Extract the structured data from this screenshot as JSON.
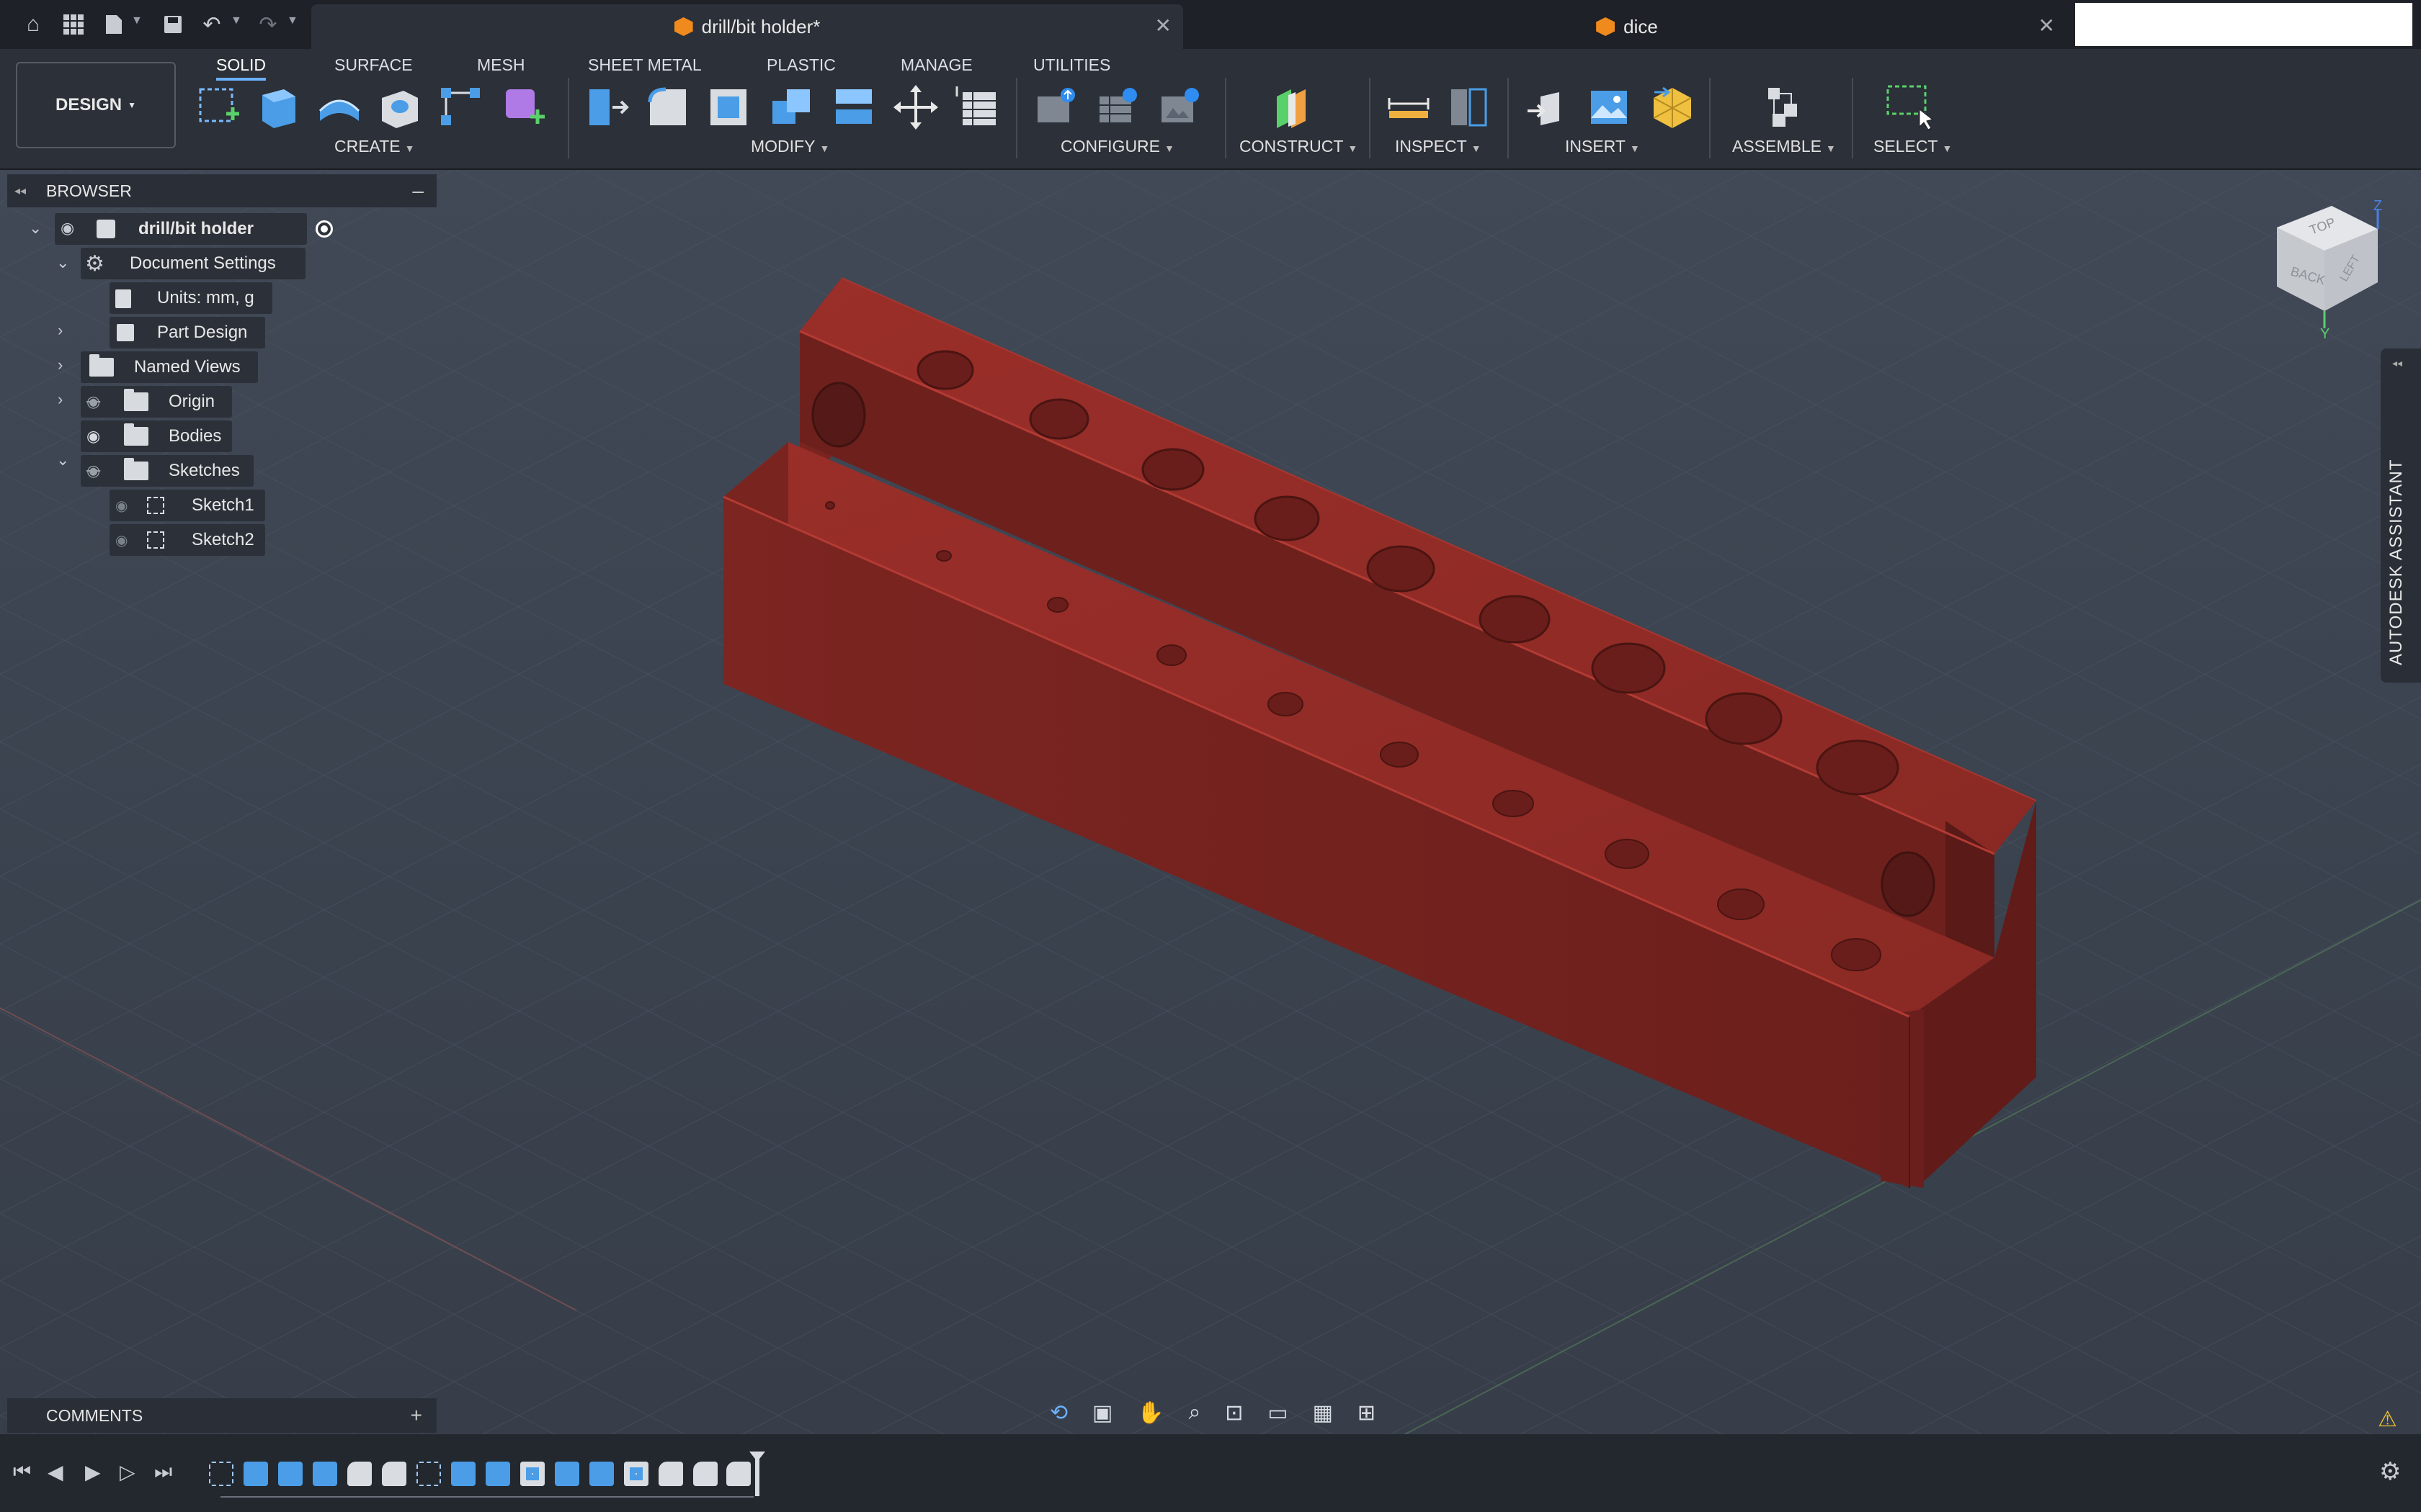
{
  "titlebar": {
    "tabs": [
      {
        "label": "drill/bit holder*",
        "active": true
      },
      {
        "label": "dice",
        "active": false
      }
    ]
  },
  "ribbon": {
    "workspace": "DESIGN",
    "tabs": [
      "SOLID",
      "SURFACE",
      "MESH",
      "SHEET METAL",
      "PLASTIC",
      "MANAGE",
      "UTILITIES"
    ],
    "groups": [
      "CREATE",
      "MODIFY",
      "CONFIGURE",
      "CONSTRUCT",
      "INSPECT",
      "INSERT",
      "ASSEMBLE",
      "SELECT"
    ]
  },
  "browser": {
    "title": "BROWSER",
    "root": "drill/bit holder",
    "items": [
      {
        "label": "Document Settings"
      },
      {
        "label": "Units: mm, g"
      },
      {
        "label": "Part Design"
      },
      {
        "label": "Named Views"
      },
      {
        "label": "Origin"
      },
      {
        "label": "Bodies"
      },
      {
        "label": "Sketches"
      },
      {
        "label": "Sketch1"
      },
      {
        "label": "Sketch2"
      }
    ]
  },
  "viewcube": {
    "top": "TOP",
    "back": "BACK",
    "left": "LEFT",
    "axis_z": "Z",
    "axis_y": "Y"
  },
  "comments": {
    "title": "COMMENTS"
  },
  "assistant": {
    "label": "AUTODESK ASSISTANT"
  },
  "colors": {
    "body": "#8a2a26",
    "accent": "#6ab0ff",
    "tab_icon": "#f08a1c",
    "background": "#3d4552"
  },
  "icons": [
    "home-icon",
    "grid-icon",
    "file-icon",
    "save-icon",
    "undo-icon",
    "redo-icon",
    "close-icon",
    "eye-icon",
    "gear-icon",
    "folder-icon",
    "sketch-icon",
    "orbit-icon",
    "pan-icon",
    "zoom-icon",
    "warning-icon",
    "settings-icon",
    "play-icon"
  ]
}
